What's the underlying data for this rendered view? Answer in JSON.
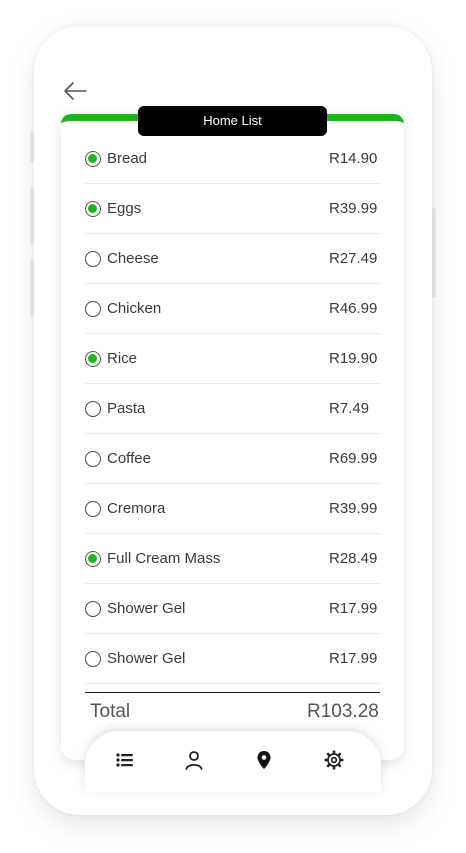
{
  "list": {
    "title": "Home List",
    "items": [
      {
        "name": "Bread",
        "price": "R14.90",
        "checked": true
      },
      {
        "name": "Eggs",
        "price": "R39.99",
        "checked": true
      },
      {
        "name": "Cheese",
        "price": "R27.49",
        "checked": false
      },
      {
        "name": "Chicken",
        "price": "R46.99",
        "checked": false
      },
      {
        "name": "Rice",
        "price": "R19.90",
        "checked": true
      },
      {
        "name": "Pasta",
        "price": "R7.49",
        "checked": false
      },
      {
        "name": "Coffee",
        "price": "R69.99",
        "checked": false
      },
      {
        "name": "Cremora",
        "price": "R39.99",
        "checked": false
      },
      {
        "name": "Full Cream Mass",
        "price": "R28.49",
        "checked": true
      },
      {
        "name": "Shower Gel",
        "price": "R17.99",
        "checked": false
      },
      {
        "name": "Shower Gel",
        "price": "R17.99",
        "checked": false
      }
    ]
  },
  "total": {
    "label": "Total",
    "value": "R103.28"
  },
  "nav": {
    "icons": [
      "list-icon",
      "user-icon",
      "location-pin-icon",
      "gear-icon"
    ]
  },
  "colors": {
    "accent": "#1fb51f",
    "title_bg": "#000000"
  }
}
